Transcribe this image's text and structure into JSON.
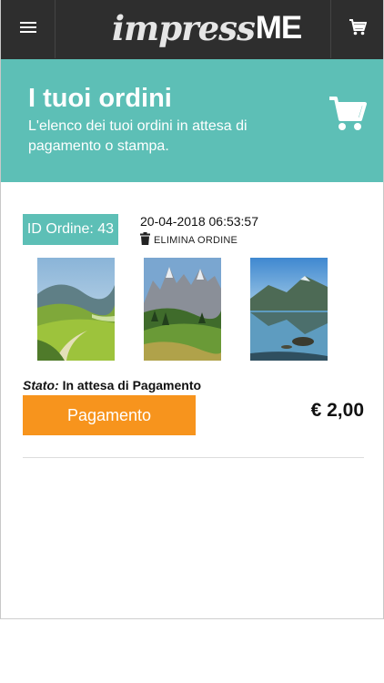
{
  "header": {
    "logo_script": "impress",
    "logo_bold": "ME",
    "menu_icon": "hamburger-icon",
    "cart_icon": "cart-icon"
  },
  "hero": {
    "title": "I tuoi ordini",
    "subtitle": "L'elenco dei tuoi ordini in attesa di pagamento o stampa.",
    "icon": "cart-icon",
    "background": "#5dbfb6"
  },
  "order": {
    "id_label": "ID Ordine: 43",
    "date": "20-04-2018 06:53:57",
    "delete_label": "ELIMINA ORDINE",
    "delete_icon": "trash-icon",
    "photos": [
      {
        "name": "photo-valley"
      },
      {
        "name": "photo-mountains"
      },
      {
        "name": "photo-lake"
      }
    ],
    "status_label": "Stato:",
    "status_value": "In attesa di Pagamento",
    "pay_button": "Pagamento",
    "price": "€ 2,00",
    "pay_color": "#f7941d"
  }
}
